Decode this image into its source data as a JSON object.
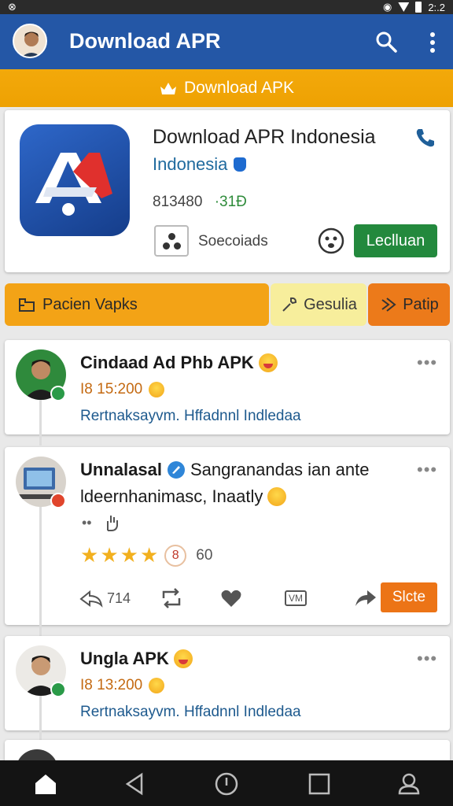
{
  "status": {
    "time": "2:.2"
  },
  "appbar": {
    "title": "Download APR"
  },
  "banner": {
    "label": "Download APK"
  },
  "app": {
    "name": "Download APR Indonesia",
    "sub": "Indonesia",
    "count": "813480",
    "count_extra": "·31Đ",
    "specials": "Soecoiads",
    "button": "Leclluan"
  },
  "tabs": [
    {
      "label": "Pacien Vapks"
    },
    {
      "label": "Gesulia"
    },
    {
      "label": "Patip"
    }
  ],
  "posts": [
    {
      "title": "Cindaad Ad Phb APK",
      "meta": "I8 15:200",
      "text": "Rertnaksayvm. Hffadnnl Indledaa"
    },
    {
      "title_bold": "Unnalasal",
      "title_rest": "Sangranandas ian ante",
      "line2": "ldeernhanimasc, Inaatly",
      "rating_badge": "8",
      "rating_count": "60",
      "reply_count": "714",
      "card_label": "VM",
      "action_button": "Slcte"
    },
    {
      "title": "Ungla APK",
      "meta": "I8 13:200",
      "text": "Rertnaksayvm. Hffadnnl Indledaa"
    }
  ],
  "colors": {
    "appbar": "#2457a6",
    "banner": "#f3a90a",
    "accent_green": "#23893d",
    "accent_orange": "#ec7416"
  },
  "icons": [
    "search-icon",
    "more-vert-icon",
    "crown-icon",
    "phone-icon",
    "home-icon",
    "back-icon",
    "power-icon",
    "square-icon",
    "account-icon"
  ]
}
